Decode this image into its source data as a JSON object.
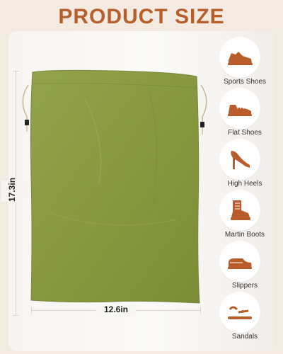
{
  "title": "PRODUCT SIZE",
  "dimensions": {
    "height": "17.3in",
    "width": "12.6in"
  },
  "colors": {
    "title": "#b85e2b",
    "icon": "#b85c2a",
    "bag": "#8a9a43",
    "background": "#f3ebe2"
  },
  "shoe_types": [
    {
      "label": "Sports Shoes",
      "icon": "sports-shoe-icon"
    },
    {
      "label": "Flat Shoes",
      "icon": "flat-shoe-icon"
    },
    {
      "label": "High Heels",
      "icon": "high-heel-icon"
    },
    {
      "label": "Martin Boots",
      "icon": "martin-boot-icon"
    },
    {
      "label": "Slippers",
      "icon": "slipper-icon"
    },
    {
      "label": "Sandals",
      "icon": "sandal-icon"
    }
  ]
}
